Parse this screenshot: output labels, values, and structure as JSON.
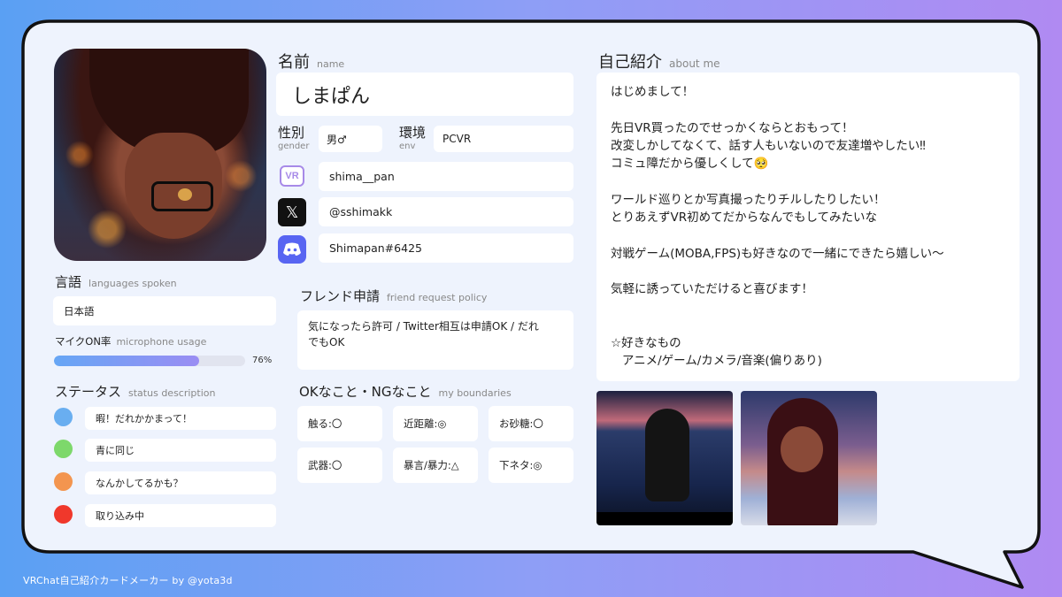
{
  "footer": "VRChat自己紹介カードメーカー by @yota3d",
  "name": {
    "label": "名前",
    "sub": "name",
    "value": "しまぱん"
  },
  "gender": {
    "label": "性別",
    "sub": "gender",
    "value": "男♂"
  },
  "env": {
    "label": "環境",
    "sub": "env",
    "value": "PCVR"
  },
  "socials": [
    {
      "icon": "vrchat-icon",
      "value": "shima__pan"
    },
    {
      "icon": "x-icon",
      "value": "@sshimakk"
    },
    {
      "icon": "discord-icon",
      "value": "Shimapan#6425"
    }
  ],
  "languages": {
    "label": "言語",
    "sub": "languages spoken",
    "value": "日本語"
  },
  "mic": {
    "label": "マイクON率",
    "sub": "microphone usage",
    "value": 76,
    "value_text": "76%"
  },
  "status": {
    "label": "ステータス",
    "sub": "status description",
    "items": [
      {
        "color": "#69aef0",
        "text": "暇！だれかかまって！"
      },
      {
        "color": "#7dd86b",
        "text": "青に同じ"
      },
      {
        "color": "#f3954f",
        "text": "なんかしてるかも？"
      },
      {
        "color": "#f0382b",
        "text": "取り込み中"
      }
    ]
  },
  "friend": {
    "label": "フレンド申請",
    "sub": "friend request policy",
    "value_line1": "気になったら許可 / Twitter相互は申請OK / だれ",
    "value_line2": "でもOK"
  },
  "boundaries": {
    "label": "OKなこと・NGなこと",
    "sub": "my boundaries",
    "items": [
      "触る:〇",
      "近距離:◎",
      "お砂糖:〇",
      "武器:〇",
      "暴言/暴力:△",
      "下ネタ:◎"
    ]
  },
  "about": {
    "label": "自己紹介",
    "sub": "about me",
    "text": "はじめまして！\n\n先日VR買ったのでせっかくならとおもって！\n改変しかしてなくて、話す人もいないので友達増やしたい‼\nコミュ障だから優しくして🥺\n\nワールド巡りとか写真撮ったりチルしたりしたい！\nとりあえずVR初めてだからなんでもしてみたいな\n\n対戦ゲーム(MOBA,FPS)も好きなので一緒にできたら嬉しい〜\n\n気軽に誘っていただけると喜びます！\n\n\n☆好きなもの\n   アニメ/ゲーム/カメラ/音楽(偏りあり)"
  },
  "colors": {
    "accent": "#9a8df3",
    "card_bg": "#eef3fd",
    "border": "#111111"
  }
}
